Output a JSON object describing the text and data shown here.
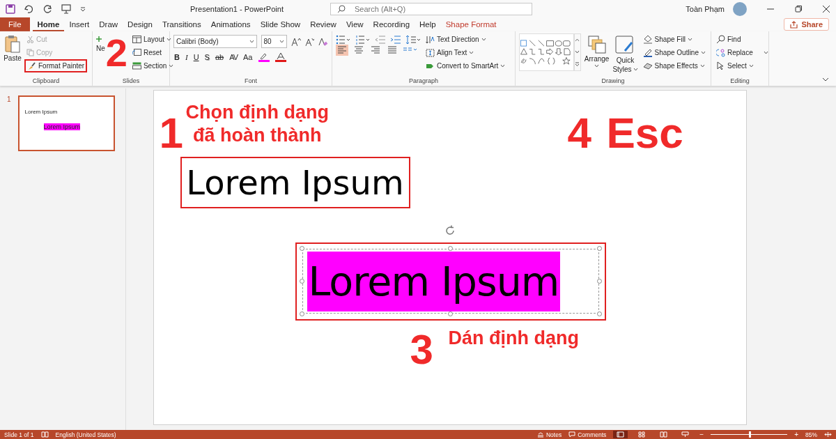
{
  "window": {
    "title": "Presentation1  -  PowerPoint",
    "user": "Toàn Phạm"
  },
  "search": {
    "placeholder": "Search (Alt+Q)"
  },
  "tabs": [
    {
      "label": "File",
      "kind": "file",
      "selected": false
    },
    {
      "label": "Home",
      "kind": "normal",
      "selected": true
    },
    {
      "label": "Insert",
      "kind": "normal",
      "selected": false
    },
    {
      "label": "Draw",
      "kind": "normal",
      "selected": false
    },
    {
      "label": "Design",
      "kind": "normal",
      "selected": false
    },
    {
      "label": "Transitions",
      "kind": "normal",
      "selected": false
    },
    {
      "label": "Animations",
      "kind": "normal",
      "selected": false
    },
    {
      "label": "Slide Show",
      "kind": "normal",
      "selected": false
    },
    {
      "label": "Review",
      "kind": "normal",
      "selected": false
    },
    {
      "label": "View",
      "kind": "normal",
      "selected": false
    },
    {
      "label": "Recording",
      "kind": "normal",
      "selected": false
    },
    {
      "label": "Help",
      "kind": "normal",
      "selected": false
    },
    {
      "label": "Shape Format",
      "kind": "contextual",
      "selected": false
    }
  ],
  "share": "Share",
  "ribbon": {
    "clipboard": {
      "label": "Clipboard",
      "paste": "Paste",
      "cut": {
        "label": "Cut",
        "disabled": true
      },
      "copy": {
        "label": "Copy",
        "disabled": true
      },
      "format_painter": {
        "label": "Format Painter",
        "highlighted": true
      }
    },
    "slides": {
      "label": "Slides",
      "new_slide": "Ne",
      "layout": "Layout",
      "reset": "Reset",
      "section": "Section"
    },
    "font": {
      "label": "Font",
      "family": "Calibri (Body)",
      "size": "80",
      "format_buttons": [
        "B",
        "I",
        "U",
        "S",
        "ab",
        "AV",
        "Aa"
      ]
    },
    "paragraph": {
      "label": "Paragraph",
      "text_direction": "Text Direction",
      "align_text": "Align Text",
      "convert": "Convert to SmartArt",
      "alignments": [
        {
          "kind": "left",
          "selected": true
        },
        {
          "kind": "center",
          "selected": false
        },
        {
          "kind": "right",
          "selected": false
        },
        {
          "kind": "justify",
          "selected": false
        }
      ]
    },
    "drawing": {
      "label": "Drawing",
      "arrange": "Arrange",
      "quick_styles": [
        "Quick",
        "Styles"
      ],
      "shape_fill": "Shape Fill",
      "shape_outline": "Shape Outline",
      "shape_effects": "Shape Effects"
    },
    "editing": {
      "label": "Editing",
      "find": "Find",
      "replace": "Replace",
      "select": "Select"
    }
  },
  "thumbnails": [
    {
      "number": "1",
      "selected": true,
      "title": "Lorem Ipsum",
      "pasted": "Lorem Ipsum"
    }
  ],
  "slide": {
    "title_text": "Lorem Ipsum",
    "pasted_text": "Lorem Ipsum"
  },
  "annotations": [
    {
      "number": "1",
      "lines": [
        "Chọn định dạng",
        "đã hoàn thành"
      ]
    },
    {
      "number": "2"
    },
    {
      "number": "3",
      "lines": [
        "Dán định dạng"
      ]
    },
    {
      "number": "4",
      "lines": [
        "Esc"
      ]
    }
  ],
  "status_bar": {
    "slide": "Slide 1 of 1",
    "language": "English (United States)",
    "notes": "Notes",
    "comments": "Comments",
    "views": [
      {
        "kind": "normal",
        "selected": true
      },
      {
        "kind": "sorter",
        "selected": false
      },
      {
        "kind": "reading",
        "selected": false
      },
      {
        "kind": "show",
        "selected": false
      }
    ],
    "zoom_out": "−",
    "zoom_in": "+",
    "zoom": {
      "level": 0.5
    },
    "zoom_text": "85%"
  }
}
